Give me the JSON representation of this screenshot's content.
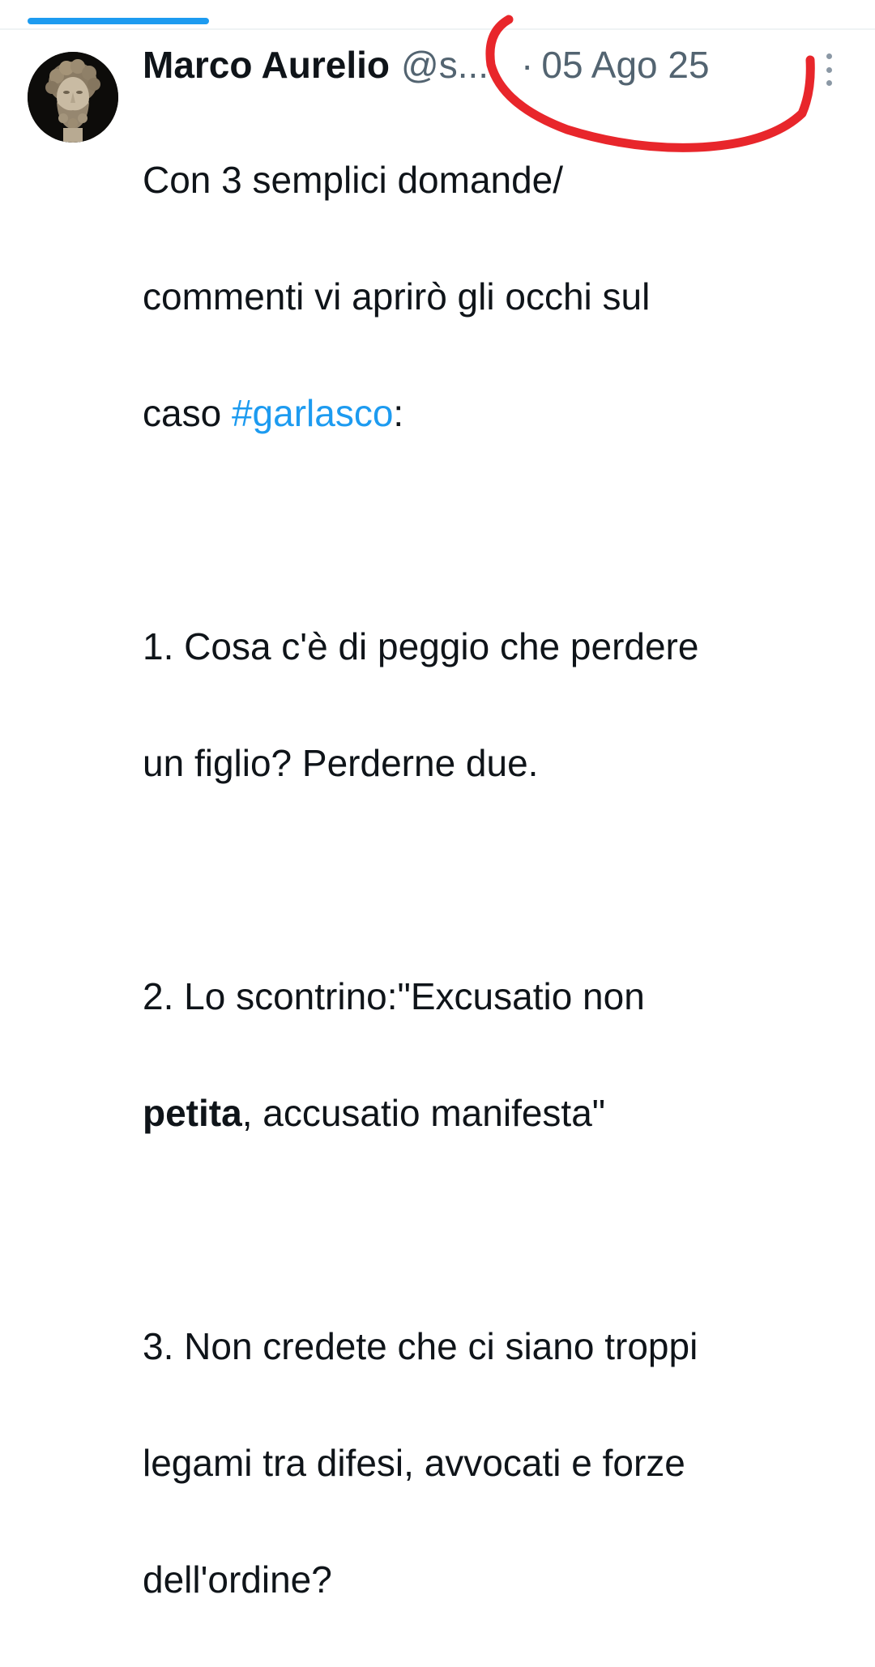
{
  "tweet": {
    "author_name": "Marco Aurelio",
    "handle": "@s...",
    "separator": "·",
    "date": "05 Ago 25",
    "lines": {
      "l1": "Con 3 semplici domande/",
      "l2": "commenti vi aprirò gli occhi sul",
      "l3_prefix": "caso ",
      "hashtag": "#garlasco",
      "l3_suffix": ":",
      "p1_line1": "1. Cosa c'è di peggio che perdere",
      "p1_line2": "un figlio? Perderne due.",
      "p2_line1": "2. Lo scontrino:\"Excusatio non",
      "p2_bold": "petita",
      "p2_line2_rest": ", accusatio manifesta\"",
      "p3_line1": "3. Non credete che ci siano troppi",
      "p3_line2": "legami tra difesi, avvocati e forze",
      "p3_line3": "dell'ordine?"
    }
  },
  "icons": {
    "avatar": "marcus-aurelius-bust-avatar",
    "more": "more-options-vertical-dots-icon"
  },
  "colors": {
    "accent": "#1d9bf0",
    "secondary_text": "#536471",
    "primary_text": "#0f1419",
    "annotation_red": "#e8262b"
  }
}
